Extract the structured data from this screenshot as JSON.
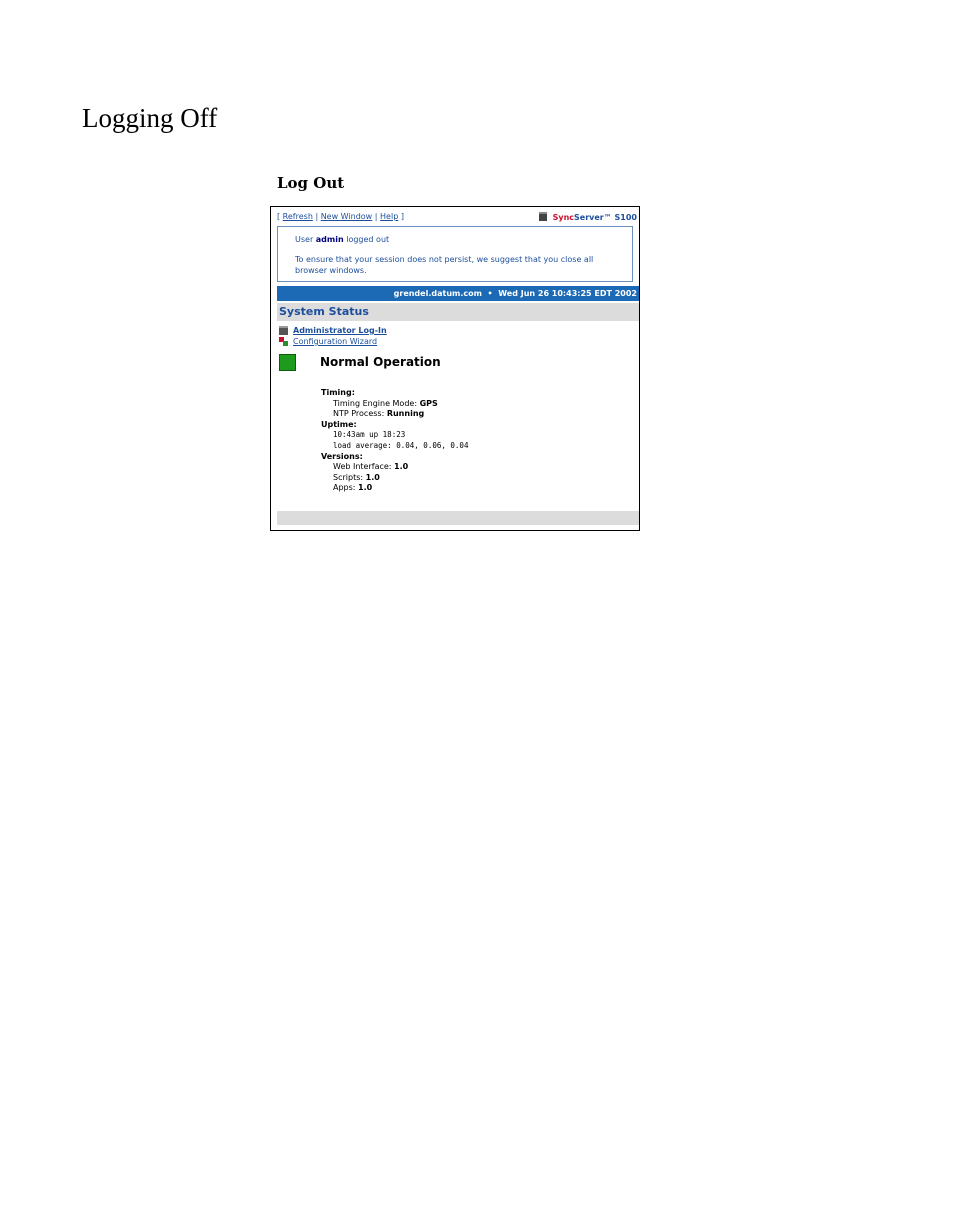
{
  "document": {
    "heading": "Logging Off",
    "caption": "Log Out"
  },
  "toolbar": {
    "open_bracket": "[",
    "refresh": "Refresh",
    "sep1": "|",
    "new_window": "New Window",
    "sep2": "|",
    "help": "Help",
    "close_bracket": "]",
    "brand_sync": "Sync",
    "brand_server": "Server",
    "brand_model": "™ S100"
  },
  "notice": {
    "prefix": "User",
    "user": "admin",
    "suffix": "logged out",
    "advice": "To ensure that your session does not persist, we suggest that you close all browser windows."
  },
  "statusbar": {
    "host": "grendel.datum.com",
    "bullet": "•",
    "datetime": "Wed Jun 26 10:43:25 EDT 2002"
  },
  "section": {
    "title": "System Status"
  },
  "nav": {
    "admin_login": "Administrator Log-In",
    "config_wizard": "Configuration Wizard"
  },
  "status": {
    "text": "Normal Operation",
    "color": "#1e9a1e"
  },
  "details": {
    "timing_title": "Timing:",
    "timing_mode_label": "Timing Engine Mode:",
    "timing_mode_value": "GPS",
    "ntp_label": "NTP Process:",
    "ntp_value": "Running",
    "uptime_title": "Uptime:",
    "uptime_line1": "10:43am up 18:23",
    "uptime_line2": "load average: 0.04, 0.06, 0.04",
    "versions_title": "Versions:",
    "web_label": "Web Interface:",
    "web_value": "1.0",
    "scripts_label": "Scripts:",
    "scripts_value": "1.0",
    "apps_label": "Apps:",
    "apps_value": "1.0"
  }
}
